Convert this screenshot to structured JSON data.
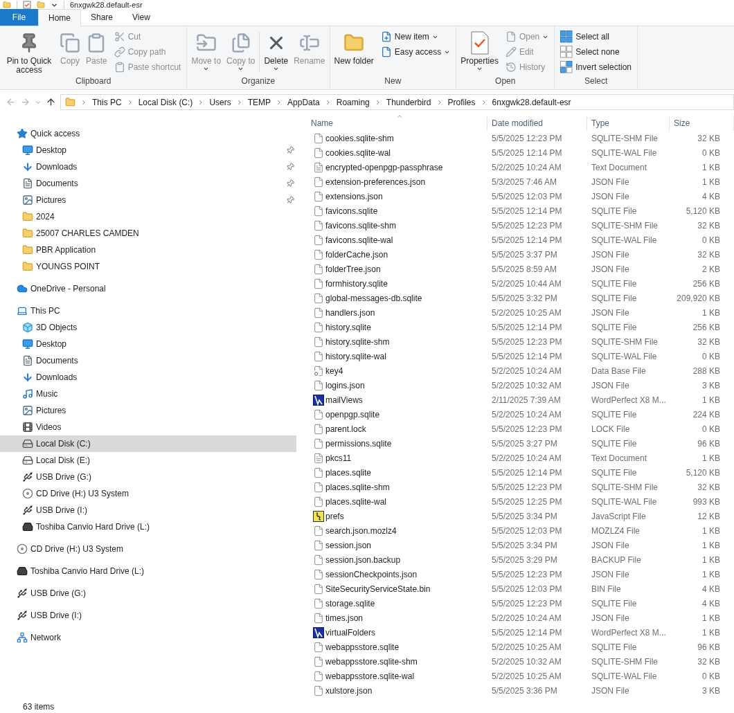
{
  "window": {
    "title": "6nxgwk28.default-esr"
  },
  "ribbon": {
    "tabs": [
      {
        "label": "File",
        "kind": "menu",
        "selected": false
      },
      {
        "label": "Home",
        "kind": "tab",
        "selected": true
      },
      {
        "label": "Share",
        "kind": "tab",
        "selected": false
      },
      {
        "label": "View",
        "kind": "tab",
        "selected": false
      }
    ],
    "groups": [
      {
        "label": "Clipboard",
        "large": [
          {
            "kind": "pin",
            "label": "Pin to Quick access",
            "disabled": false,
            "dropdown": false
          },
          {
            "kind": "copy",
            "label": "Copy",
            "disabled": true,
            "dropdown": false
          },
          {
            "kind": "paste",
            "label": "Paste",
            "disabled": true,
            "dropdown": false
          }
        ],
        "small": [
          {
            "kind": "cut",
            "label": "Cut",
            "disabled": true,
            "dropdown": false
          },
          {
            "kind": "copypath",
            "label": "Copy path",
            "disabled": true,
            "dropdown": false
          },
          {
            "kind": "pasteshortcut",
            "label": "Paste shortcut",
            "disabled": true,
            "dropdown": false
          }
        ]
      },
      {
        "label": "Organize",
        "large": [
          {
            "kind": "moveto",
            "label": "Move to",
            "disabled": true,
            "dropdown": true
          },
          {
            "kind": "copyto",
            "label": "Copy to",
            "disabled": true,
            "dropdown": true
          },
          {
            "kind": "delete",
            "label": "Delete",
            "disabled": false,
            "dropdown": true
          },
          {
            "kind": "rename",
            "label": "Rename",
            "disabled": true,
            "dropdown": false
          }
        ]
      },
      {
        "label": "New",
        "large": [
          {
            "kind": "newfolder",
            "label": "New folder",
            "disabled": false,
            "dropdown": false
          }
        ],
        "small": [
          {
            "kind": "newitem",
            "label": "New item",
            "disabled": false,
            "dropdown": true
          },
          {
            "kind": "easyaccess",
            "label": "Easy access",
            "disabled": false,
            "dropdown": true
          }
        ]
      },
      {
        "label": "Open",
        "large": [
          {
            "kind": "properties",
            "label": "Properties",
            "disabled": false,
            "dropdown": true
          }
        ],
        "small": [
          {
            "kind": "open",
            "label": "Open",
            "disabled": true,
            "dropdown": true
          },
          {
            "kind": "edit",
            "label": "Edit",
            "disabled": true,
            "dropdown": false
          },
          {
            "kind": "history",
            "label": "History",
            "disabled": true,
            "dropdown": false
          }
        ]
      },
      {
        "label": "Select",
        "small": [
          {
            "kind": "selectall",
            "label": "Select all",
            "disabled": false,
            "dropdown": false
          },
          {
            "kind": "selectnone",
            "label": "Select none",
            "disabled": false,
            "dropdown": false
          },
          {
            "kind": "invert",
            "label": "Invert selection",
            "disabled": false,
            "dropdown": false
          }
        ]
      }
    ]
  },
  "address_bar": {
    "breadcrumbs": [
      "This PC",
      "Local Disk (C:)",
      "Users",
      "TEMP",
      "AppData",
      "Roaming",
      "Thunderbird",
      "Profiles",
      "6nxgwk28.default-esr"
    ]
  },
  "nav": {
    "items": [
      {
        "kind": "star",
        "label": "Quick access",
        "selected": false,
        "children": [
          {
            "kind": "desktop",
            "label": "Desktop",
            "selected": false,
            "pinned": true
          },
          {
            "kind": "download",
            "label": "Downloads",
            "selected": false,
            "pinned": true
          },
          {
            "kind": "document",
            "label": "Documents",
            "selected": false,
            "pinned": true
          },
          {
            "kind": "picture",
            "label": "Pictures",
            "selected": false,
            "pinned": true
          },
          {
            "kind": "folder",
            "label": "2024",
            "selected": false,
            "pinned": false
          },
          {
            "kind": "folder",
            "label": "25007 CHARLES CAMDEN",
            "selected": false,
            "pinned": false
          },
          {
            "kind": "folder",
            "label": "PBR Application",
            "selected": false,
            "pinned": false
          },
          {
            "kind": "folder",
            "label": "YOUNGS POINT",
            "selected": false,
            "pinned": false
          }
        ]
      },
      {
        "kind": "cloud",
        "label": "OneDrive - Personal",
        "selected": false
      },
      {
        "kind": "pc",
        "label": "This PC",
        "selected": false,
        "children": [
          {
            "kind": "cube",
            "label": "3D Objects",
            "selected": false
          },
          {
            "kind": "desktop",
            "label": "Desktop",
            "selected": false
          },
          {
            "kind": "document",
            "label": "Documents",
            "selected": false
          },
          {
            "kind": "download",
            "label": "Downloads",
            "selected": false
          },
          {
            "kind": "music",
            "label": "Music",
            "selected": false
          },
          {
            "kind": "picture",
            "label": "Pictures",
            "selected": false
          },
          {
            "kind": "video",
            "label": "Videos",
            "selected": false
          },
          {
            "kind": "drive",
            "label": "Local Disk (C:)",
            "selected": true
          },
          {
            "kind": "drive",
            "label": "Local Disk (E:)",
            "selected": false
          },
          {
            "kind": "usb",
            "label": "USB Drive (G:)",
            "selected": false
          },
          {
            "kind": "cd",
            "label": "CD Drive (H:) U3 System",
            "selected": false
          },
          {
            "kind": "usb",
            "label": "USB Drive (I:)",
            "selected": false
          },
          {
            "kind": "hdd",
            "label": "Toshiba Canvio Hard Drive (L:)",
            "selected": false
          }
        ]
      },
      {
        "kind": "cd",
        "label": "CD Drive (H:) U3 System",
        "selected": false
      },
      {
        "kind": "hdd",
        "label": "Toshiba Canvio Hard Drive (L:)",
        "selected": false
      },
      {
        "kind": "usb",
        "label": "USB Drive (G:)",
        "selected": false
      },
      {
        "kind": "usb",
        "label": "USB Drive (I:)",
        "selected": false
      },
      {
        "kind": "network",
        "label": "Network",
        "selected": false
      }
    ]
  },
  "table": {
    "columns": [
      {
        "label": "Name",
        "sorted": true
      },
      {
        "label": "Date modified",
        "sorted": false
      },
      {
        "label": "Type",
        "sorted": false
      },
      {
        "label": "Size",
        "sorted": false
      }
    ],
    "rows": [
      {
        "kind": "blank",
        "name": "cookies.sqlite-shm",
        "date": "5/5/2025 12:23 PM",
        "type": "SQLITE-SHM File",
        "size": "32 KB"
      },
      {
        "kind": "blank",
        "name": "cookies.sqlite-wal",
        "date": "5/5/2025 12:14 PM",
        "type": "SQLITE-WAL File",
        "size": "0 KB"
      },
      {
        "kind": "text",
        "name": "encrypted-openpgp-passphrase",
        "date": "5/2/2025 10:24 AM",
        "type": "Text Document",
        "size": "1 KB"
      },
      {
        "kind": "blank",
        "name": "extension-preferences.json",
        "date": "5/3/2025 7:46 AM",
        "type": "JSON File",
        "size": "1 KB"
      },
      {
        "kind": "blank",
        "name": "extensions.json",
        "date": "5/5/2025 12:03 PM",
        "type": "JSON File",
        "size": "4 KB"
      },
      {
        "kind": "blank",
        "name": "favicons.sqlite",
        "date": "5/5/2025 12:14 PM",
        "type": "SQLITE File",
        "size": "5,120 KB"
      },
      {
        "kind": "blank",
        "name": "favicons.sqlite-shm",
        "date": "5/5/2025 12:23 PM",
        "type": "SQLITE-SHM File",
        "size": "32 KB"
      },
      {
        "kind": "blank",
        "name": "favicons.sqlite-wal",
        "date": "5/5/2025 12:14 PM",
        "type": "SQLITE-WAL File",
        "size": "0 KB"
      },
      {
        "kind": "blank",
        "name": "folderCache.json",
        "date": "5/5/2025 3:37 PM",
        "type": "JSON File",
        "size": "32 KB"
      },
      {
        "kind": "blank",
        "name": "folderTree.json",
        "date": "5/5/2025 8:59 AM",
        "type": "JSON File",
        "size": "2 KB"
      },
      {
        "kind": "blank",
        "name": "formhistory.sqlite",
        "date": "5/2/2025 10:44 AM",
        "type": "SQLITE File",
        "size": "256 KB"
      },
      {
        "kind": "blank",
        "name": "global-messages-db.sqlite",
        "date": "5/5/2025 3:32 PM",
        "type": "SQLITE File",
        "size": "209,920 KB"
      },
      {
        "kind": "blank",
        "name": "handlers.json",
        "date": "5/2/2025 10:25 AM",
        "type": "JSON File",
        "size": "1 KB"
      },
      {
        "kind": "blank",
        "name": "history.sqlite",
        "date": "5/5/2025 12:14 PM",
        "type": "SQLITE File",
        "size": "256 KB"
      },
      {
        "kind": "blank",
        "name": "history.sqlite-shm",
        "date": "5/5/2025 12:23 PM",
        "type": "SQLITE-SHM File",
        "size": "32 KB"
      },
      {
        "kind": "blank",
        "name": "history.sqlite-wal",
        "date": "5/5/2025 12:14 PM",
        "type": "SQLITE-WAL File",
        "size": "0 KB"
      },
      {
        "kind": "db",
        "name": "key4",
        "date": "5/2/2025 10:24 AM",
        "type": "Data Base File",
        "size": "288 KB"
      },
      {
        "kind": "blank",
        "name": "logins.json",
        "date": "5/2/2025 10:32 AM",
        "type": "JSON File",
        "size": "3 KB"
      },
      {
        "kind": "wordperfect",
        "name": "mailViews",
        "date": "2/11/2025 7:39 AM",
        "type": "WordPerfect X8 M...",
        "size": "1 KB"
      },
      {
        "kind": "blank",
        "name": "openpgp.sqlite",
        "date": "5/2/2025 10:24 AM",
        "type": "SQLITE File",
        "size": "224 KB"
      },
      {
        "kind": "blank",
        "name": "parent.lock",
        "date": "5/5/2025 12:23 PM",
        "type": "LOCK File",
        "size": "0 KB"
      },
      {
        "kind": "blank",
        "name": "permissions.sqlite",
        "date": "5/5/2025 3:27 PM",
        "type": "SQLITE File",
        "size": "96 KB"
      },
      {
        "kind": "text",
        "name": "pkcs11",
        "date": "5/2/2025 10:24 AM",
        "type": "Text Document",
        "size": "1 KB"
      },
      {
        "kind": "blank",
        "name": "places.sqlite",
        "date": "5/5/2025 12:14 PM",
        "type": "SQLITE File",
        "size": "5,120 KB"
      },
      {
        "kind": "blank",
        "name": "places.sqlite-shm",
        "date": "5/5/2025 12:23 PM",
        "type": "SQLITE-SHM File",
        "size": "32 KB"
      },
      {
        "kind": "blank",
        "name": "places.sqlite-wal",
        "date": "5/5/2025 12:25 PM",
        "type": "SQLITE-WAL File",
        "size": "993 KB"
      },
      {
        "kind": "js",
        "name": "prefs",
        "date": "5/5/2025 3:34 PM",
        "type": "JavaScript File",
        "size": "12 KB"
      },
      {
        "kind": "blank",
        "name": "search.json.mozlz4",
        "date": "5/5/2025 12:03 PM",
        "type": "MOZLZ4 File",
        "size": "1 KB"
      },
      {
        "kind": "blank",
        "name": "session.json",
        "date": "5/5/2025 3:34 PM",
        "type": "JSON File",
        "size": "1 KB"
      },
      {
        "kind": "blank",
        "name": "session.json.backup",
        "date": "5/5/2025 3:29 PM",
        "type": "BACKUP File",
        "size": "1 KB"
      },
      {
        "kind": "blank",
        "name": "sessionCheckpoints.json",
        "date": "5/5/2025 12:23 PM",
        "type": "JSON File",
        "size": "1 KB"
      },
      {
        "kind": "blank",
        "name": "SiteSecurityServiceState.bin",
        "date": "5/5/2025 12:03 PM",
        "type": "BIN File",
        "size": "4 KB"
      },
      {
        "kind": "blank",
        "name": "storage.sqlite",
        "date": "5/5/2025 12:23 PM",
        "type": "SQLITE File",
        "size": "4 KB"
      },
      {
        "kind": "blank",
        "name": "times.json",
        "date": "5/2/2025 10:24 AM",
        "type": "JSON File",
        "size": "1 KB"
      },
      {
        "kind": "wordperfect",
        "name": "virtualFolders",
        "date": "5/5/2025 12:14 PM",
        "type": "WordPerfect X8 M...",
        "size": "1 KB"
      },
      {
        "kind": "blank",
        "name": "webappsstore.sqlite",
        "date": "5/2/2025 10:25 AM",
        "type": "SQLITE File",
        "size": "96 KB"
      },
      {
        "kind": "blank",
        "name": "webappsstore.sqlite-shm",
        "date": "5/2/2025 10:32 AM",
        "type": "SQLITE-SHM File",
        "size": "32 KB"
      },
      {
        "kind": "blank",
        "name": "webappsstore.sqlite-wal",
        "date": "5/2/2025 10:25 AM",
        "type": "SQLITE-WAL File",
        "size": "0 KB"
      },
      {
        "kind": "blank",
        "name": "xulstore.json",
        "date": "5/5/2025 3:36 PM",
        "type": "JSON File",
        "size": "3 KB"
      }
    ]
  },
  "status_bar": {
    "item_count": "63 items"
  }
}
